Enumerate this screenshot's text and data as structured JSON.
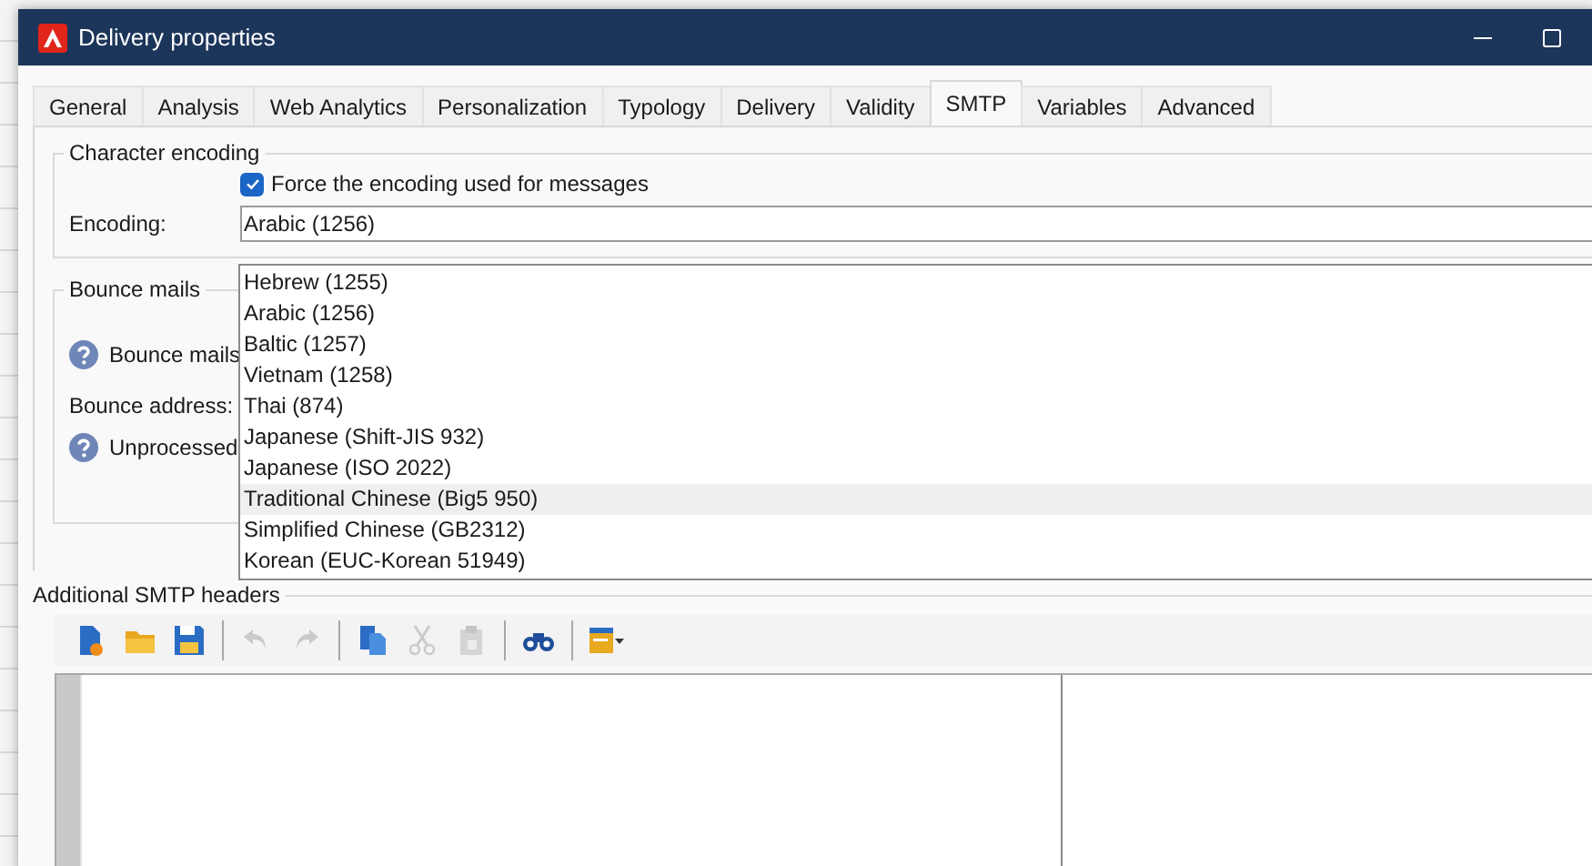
{
  "window": {
    "title": "Delivery properties"
  },
  "tabs": [
    {
      "label": "General",
      "selected": false
    },
    {
      "label": "Analysis",
      "selected": false
    },
    {
      "label": "Web Analytics",
      "selected": false
    },
    {
      "label": "Personalization",
      "selected": false
    },
    {
      "label": "Typology",
      "selected": false
    },
    {
      "label": "Delivery",
      "selected": false
    },
    {
      "label": "Validity",
      "selected": false
    },
    {
      "label": "SMTP",
      "selected": true
    },
    {
      "label": "Variables",
      "selected": false
    },
    {
      "label": "Advanced",
      "selected": false
    }
  ],
  "character_encoding": {
    "title": "Character encoding",
    "force_checkbox": {
      "label": "Force the encoding used for messages",
      "checked": true
    },
    "encoding_label": "Encoding:",
    "encoding_value": "Arabic (1256)"
  },
  "encoding_dropdown": [
    {
      "label": "Hebrew (1255)",
      "selected": false
    },
    {
      "label": "Arabic (1256)",
      "selected": false
    },
    {
      "label": "Baltic (1257)",
      "selected": false
    },
    {
      "label": "Vietnam (1258)",
      "selected": false
    },
    {
      "label": "Thai (874)",
      "selected": false
    },
    {
      "label": "Japanese (Shift-JIS 932)",
      "selected": false
    },
    {
      "label": "Japanese (ISO 2022)",
      "selected": false
    },
    {
      "label": "Traditional Chinese (Big5 950)",
      "selected": true
    },
    {
      "label": "Simplified Chinese (GB2312)",
      "selected": false
    },
    {
      "label": "Korean (EUC-Korean 51949)",
      "selected": false
    }
  ],
  "bounce_mails": {
    "title": "Bounce mails",
    "bounce_mails_label": "Bounce mails",
    "bounce_address_label": "Bounce address:",
    "unprocessed_label": "Unprocessed"
  },
  "smtp_headers": {
    "title": "Additional SMTP headers",
    "toolbar": [
      {
        "kind": "new",
        "disabled": false
      },
      {
        "kind": "open",
        "disabled": false
      },
      {
        "kind": "save",
        "disabled": false
      },
      {
        "kind": "sep"
      },
      {
        "kind": "undo",
        "disabled": true
      },
      {
        "kind": "redo",
        "disabled": true
      },
      {
        "kind": "sep"
      },
      {
        "kind": "copy",
        "disabled": false
      },
      {
        "kind": "cut",
        "disabled": true
      },
      {
        "kind": "paste",
        "disabled": true
      },
      {
        "kind": "sep"
      },
      {
        "kind": "find",
        "disabled": false
      },
      {
        "kind": "sep"
      },
      {
        "kind": "panel",
        "disabled": false
      }
    ]
  }
}
